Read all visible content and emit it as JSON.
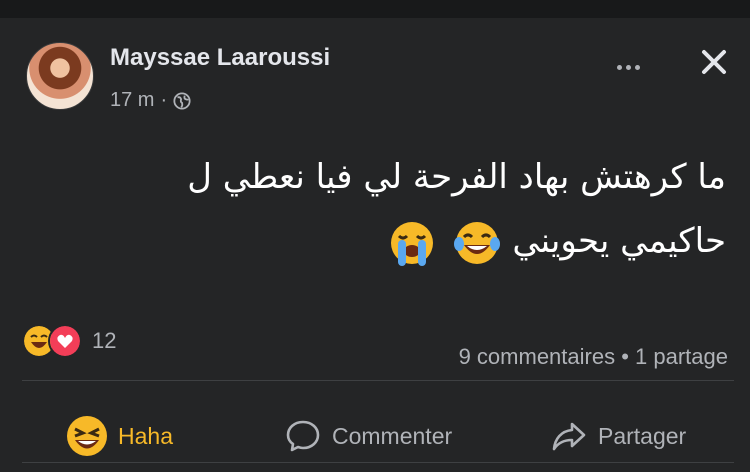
{
  "post": {
    "author": "Mayssae Laaroussi",
    "time": "17 m",
    "separator": "·",
    "text_line1": "ما كرهتش بهاد الفرحة لي فيا نعطي ل",
    "text_line2": "حاكيمي يحويني",
    "reaction_count": "12",
    "comments": "9 commentaires",
    "stats_separator": " • ",
    "shares": "1 partage"
  },
  "actions": {
    "haha": "Haha",
    "comment": "Commenter",
    "share": "Partager"
  },
  "icons": {
    "more": "more-options-icon",
    "close": "close-icon",
    "audience": "globe-icon",
    "reaction_1": "haha-reaction-icon",
    "reaction_2": "love-reaction-icon",
    "emoji_1": "laughing-crying-emoji",
    "emoji_2": "loudly-crying-emoji"
  },
  "colors": {
    "background": "#242526",
    "text": "#e4e6eb",
    "secondary": "#b0b3b8",
    "haha": "#f7b928",
    "love": "#f33e58"
  }
}
